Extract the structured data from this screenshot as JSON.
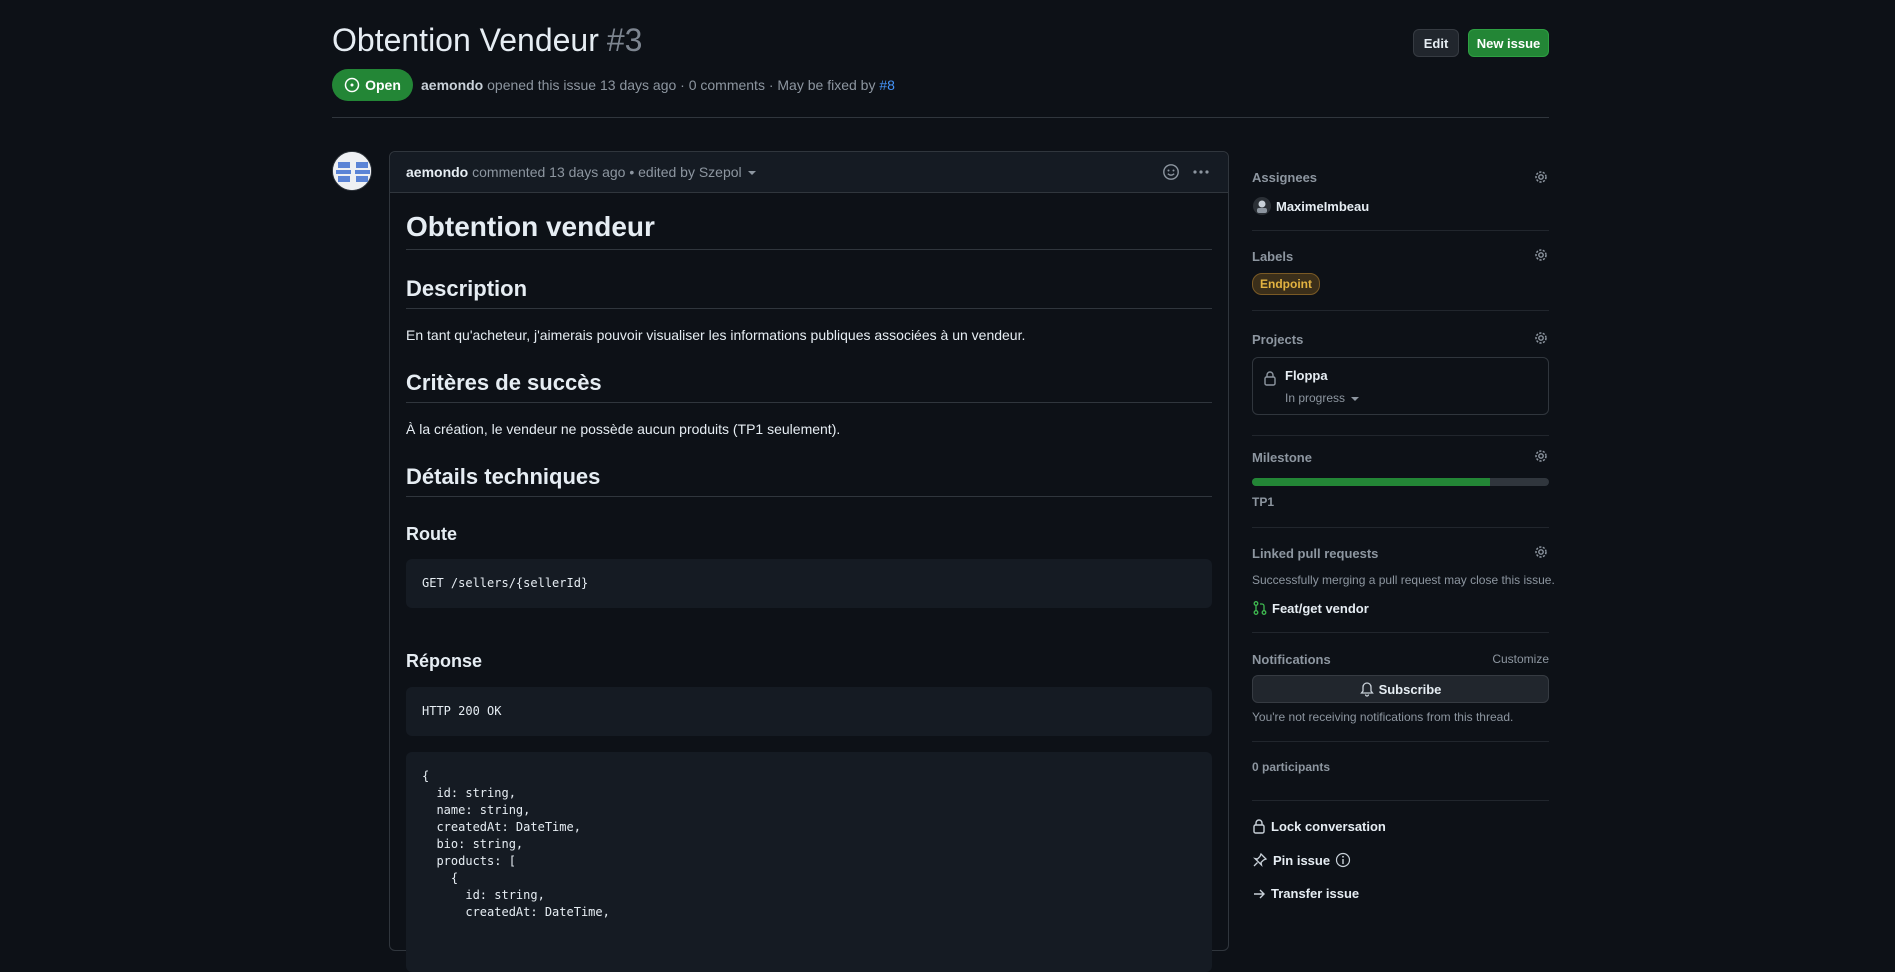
{
  "header": {
    "title": "Obtention Vendeur",
    "number": "#3",
    "edit_label": "Edit",
    "new_issue_label": "New issue",
    "state": "Open",
    "author": "aemondo",
    "meta_text": "opened this issue 13 days ago · 0 comments · May be fixed by",
    "fix_link": "#8"
  },
  "comment": {
    "author": "aemondo",
    "meta": "commented 13 days ago • edited by Szepol",
    "h1": "Obtention vendeur",
    "description_heading": "Description",
    "description": "En tant qu'acheteur, j'aimerais pouvoir visualiser les informations publiques associées à un vendeur.",
    "criteria_heading": "Critères de succès",
    "criteria": "À la création, le vendeur ne possède aucun produits (TP1 seulement).",
    "tech_heading": "Détails techniques",
    "route_heading": "Route",
    "route_code": "GET /sellers/{sellerId}",
    "response_heading": "Réponse",
    "response_code": "HTTP 200 OK",
    "json_code": "{\n  id: string,\n  name: string,\n  createdAt: DateTime,\n  bio: string,\n  products: [\n    {\n      id: string,\n      createdAt: DateTime,"
  },
  "sidebar": {
    "assignees_title": "Assignees",
    "assignee": "MaximeImbeau",
    "labels_title": "Labels",
    "label": "Endpoint",
    "label_color": "#e3b341",
    "projects_title": "Projects",
    "project_name": "Floppa",
    "project_status": "In progress",
    "milestone_title": "Milestone",
    "milestone_progress": 0.8,
    "milestone_name": "TP1",
    "lpr_title": "Linked pull requests",
    "lpr_desc": "Successfully merging a pull request may close this issue.",
    "lpr_item": "Feat/get vendor",
    "notifications_title": "Notifications",
    "customize": "Customize",
    "subscribe": "Subscribe",
    "notif_desc": "You're not receiving notifications from this thread.",
    "participants": "0 participants",
    "lock": "Lock conversation",
    "pin": "Pin issue",
    "transfer": "Transfer issue"
  }
}
